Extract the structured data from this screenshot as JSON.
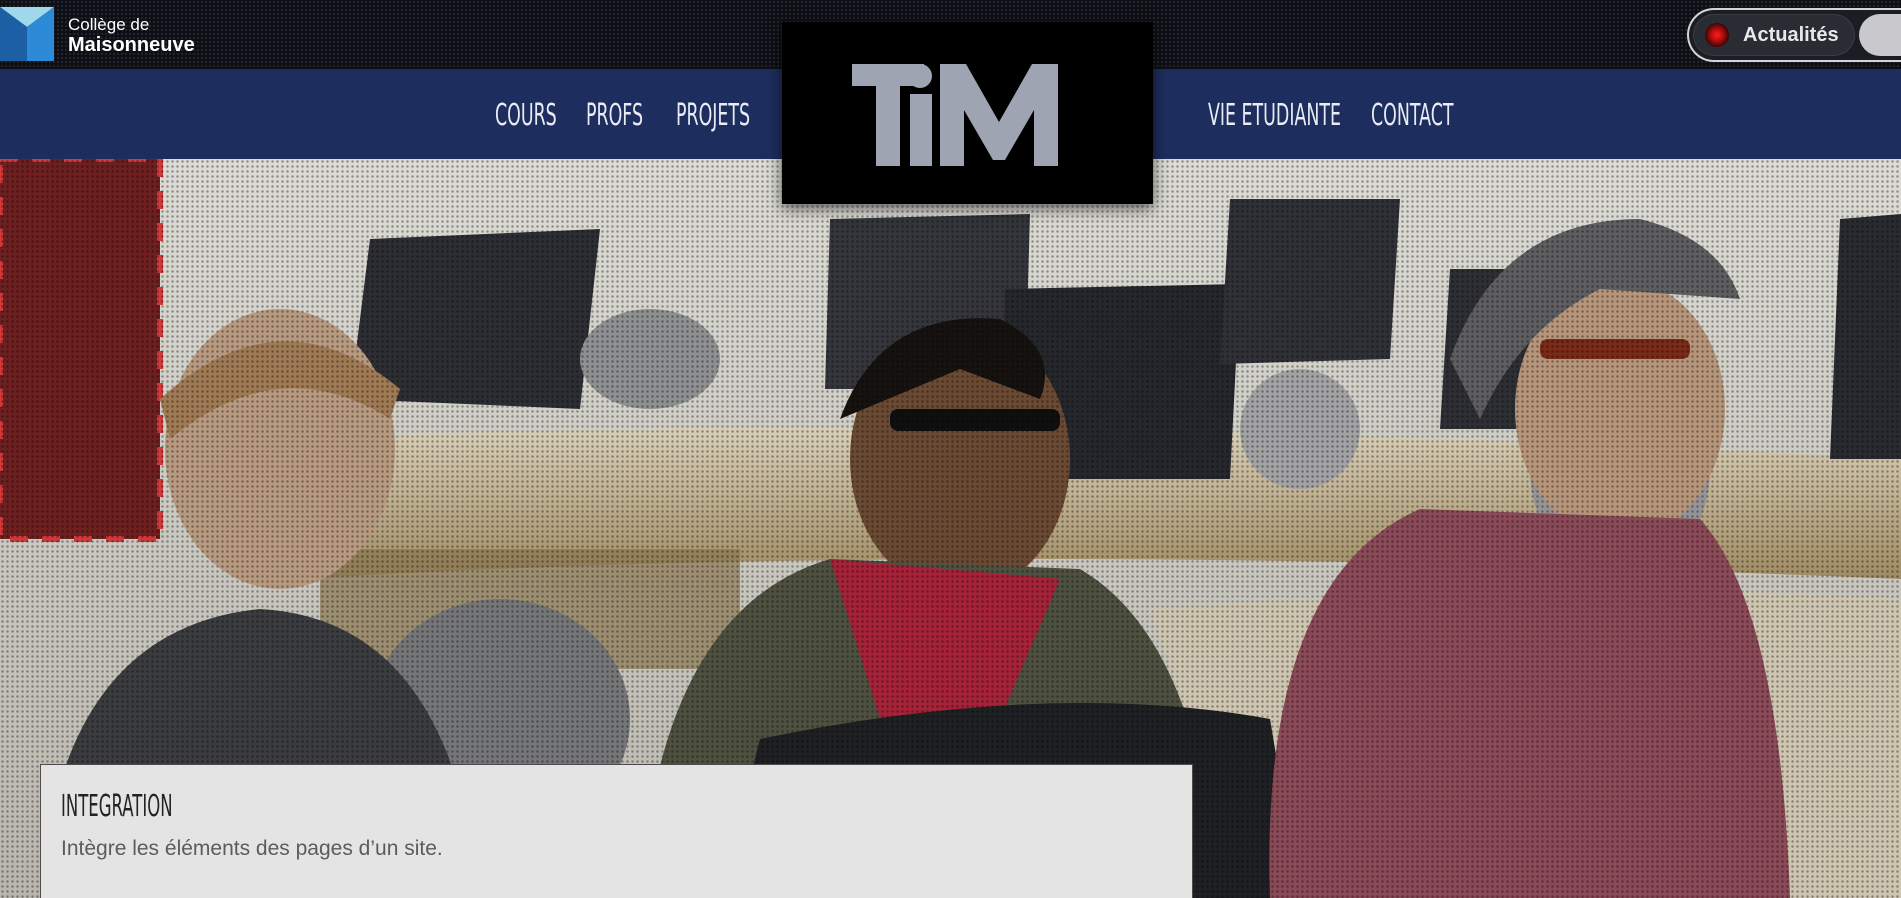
{
  "college": {
    "line1": "Collège de",
    "line2": "Maisonneuve",
    "logo_icon": "college-maisonneuve-logo"
  },
  "news_toggle": {
    "label": "Actualités",
    "indicator_color": "#e01010"
  },
  "nav": {
    "items": [
      {
        "label": "COURS"
      },
      {
        "label": "PROFS"
      },
      {
        "label": "PROJETS"
      },
      {
        "label": "VIE ETUDIANTE"
      },
      {
        "label": "CONTACT"
      }
    ],
    "background": "#1d2d5e"
  },
  "brand": {
    "logo_text": "TIM",
    "logo_color": "#9ea4b2"
  },
  "course": {
    "title": "INTEGRATION",
    "description": "Intègre les éléments des pages d’un site."
  }
}
